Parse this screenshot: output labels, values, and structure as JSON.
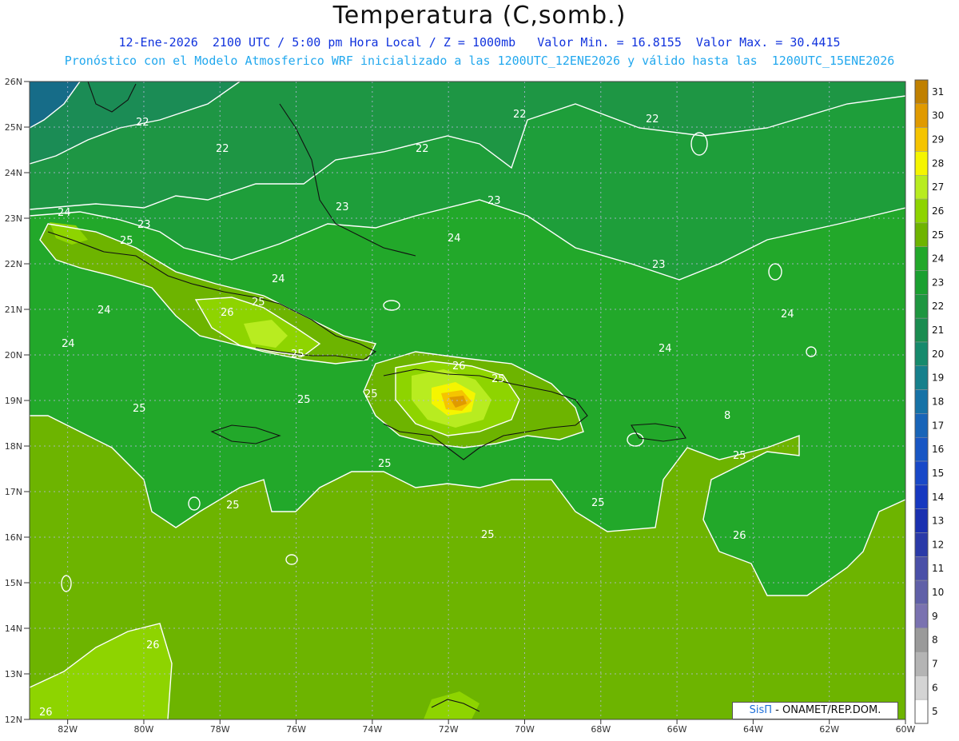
{
  "title": "Temperatura (C,somb.)",
  "subtitle_line1": "12-Ene-2026  2100 UTC / 5:00 pm Hora Local / Z = 1000mb   Valor Min. = 16.8155  Valor Max. = 30.4415",
  "subtitle_line2": "Pronóstico con el Modelo Atmosferico WRF inicializado a las 1200UTC_12ENE2026 y válido hasta las  1200UTC_15ENE2026",
  "credit": {
    "brand": "SisΠ",
    "text": " - ONAMET/REP.DOM."
  },
  "lat_labels": [
    "26N",
    "25N",
    "24N",
    "23N",
    "22N",
    "21N",
    "20N",
    "19N",
    "18N",
    "17N",
    "16N",
    "15N",
    "14N",
    "13N",
    "12N"
  ],
  "lon_labels": [
    "82W",
    "80W",
    "78W",
    "76W",
    "74W",
    "72W",
    "70W",
    "68W",
    "66W",
    "64W",
    "62W",
    "60W"
  ],
  "colorbar": {
    "labels": [
      "31",
      "30",
      "29",
      "28",
      "27",
      "26",
      "25",
      "24",
      "23",
      "22",
      "21",
      "20",
      "19",
      "18",
      "17",
      "16",
      "15",
      "14",
      "13",
      "12",
      "11",
      "10",
      "9",
      "8",
      "7",
      "6",
      "5"
    ],
    "colors": [
      "#c08000",
      "#e09a00",
      "#f5c400",
      "#f5f500",
      "#b8ec20",
      "#8ed400",
      "#6eb400",
      "#22a82a",
      "#1aa030",
      "#1e9640",
      "#1a8c50",
      "#168a6c",
      "#16808c",
      "#1672a6",
      "#1864b8",
      "#1856c4",
      "#1848c8",
      "#1638c0",
      "#1a30b0",
      "#2a3aa8",
      "#4a50a8",
      "#6060a8",
      "#7a72b0",
      "#9a9a9a",
      "#b4b4b4",
      "#d4d4d4",
      "#ffffff"
    ]
  },
  "contour_labels": [
    "22",
    "22",
    "22",
    "22",
    "22",
    "23",
    "23",
    "23",
    "23",
    "24",
    "24",
    "24",
    "24",
    "24",
    "24",
    "24",
    "25",
    "25",
    "25",
    "25",
    "25",
    "25",
    "25",
    "25",
    "25",
    "25",
    "25",
    "25",
    "26",
    "26",
    "26",
    "26",
    "26",
    "8"
  ],
  "colors": {
    "base": "#6db400",
    "band24": "#22a82a",
    "band23": "#1e9e3a",
    "band22": "#1e9644",
    "band21": "#1b8c55",
    "cold": "#166c88",
    "band26": "#8ed400",
    "band27": "#b8ec20",
    "band28": "#f5f500",
    "band29": "#f5c400",
    "band30": "#e09a00"
  }
}
